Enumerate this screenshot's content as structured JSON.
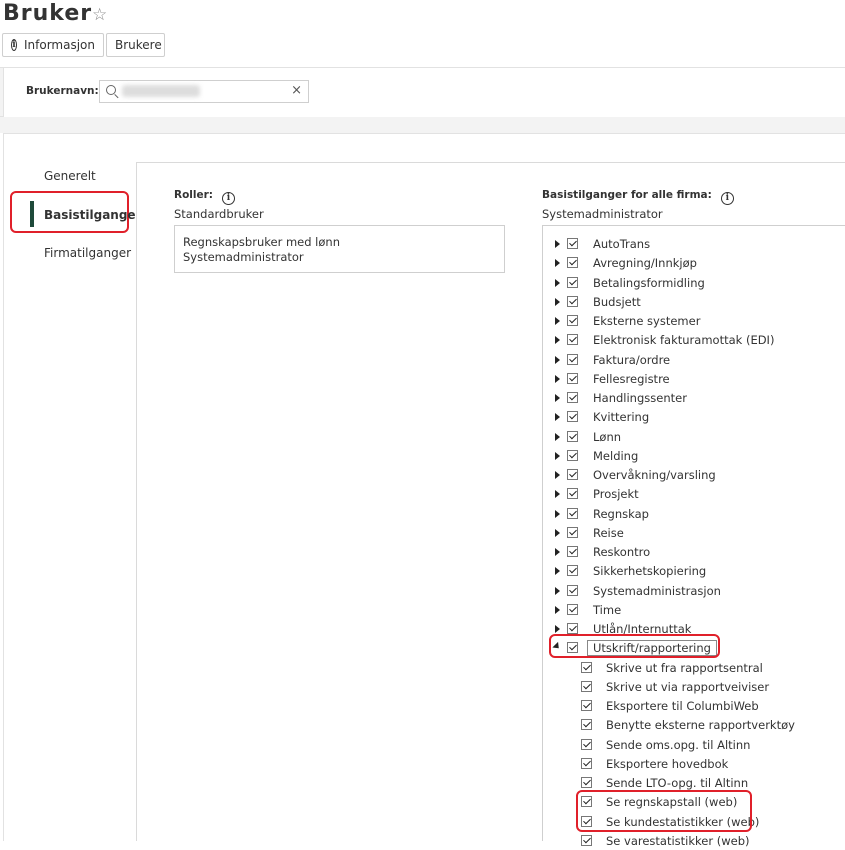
{
  "header": {
    "title": "Bruker",
    "star_icon": "star-outline-icon",
    "buttons": {
      "info": "Informasjon",
      "users": "Brukere"
    }
  },
  "search": {
    "label": "Brukernavn:",
    "value": "",
    "clear_symbol": "×"
  },
  "nav": {
    "items": [
      "Generelt",
      "Basistilganger",
      "Firmatilganger"
    ],
    "active": "Basistilganger"
  },
  "roles": {
    "label": "Roller:",
    "subtitle": "Standardbruker",
    "list": [
      "Regnskapsbruker med lønn",
      "Systemadministrator"
    ]
  },
  "access": {
    "label": "Basistilganger for alle firma:",
    "subtitle": "Systemadministrator",
    "modules": [
      "AutoTrans",
      "Avregning/Innkjøp",
      "Betalingsformidling",
      "Budsjett",
      "Eksterne systemer",
      "Elektronisk fakturamottak (EDI)",
      "Faktura/ordre",
      "Fellesregistre",
      "Handlingssenter",
      "Kvittering",
      "Lønn",
      "Melding",
      "Overvåkning/varsling",
      "Prosjekt",
      "Regnskap",
      "Reise",
      "Reskontro",
      "Sikkerhetskopiering",
      "Systemadministrasjon",
      "Time",
      "Utlån/Internuttak"
    ],
    "expanded": {
      "label": "Utskrift/rapportering",
      "children": [
        "Skrive ut fra rapportsentral",
        "Skrive ut via rapportveiviser",
        "Eksportere til ColumbiWeb",
        "Benytte eksterne rapportverktøy",
        "Sende oms.opg. til Altinn",
        "Eksportere hovedbok",
        "Sende LTO-opg. til Altinn",
        "Se regnskapstall (web)",
        "Se kundestatistikker (web)",
        "Se varestatistikker (web)"
      ]
    }
  },
  "colors": {
    "highlight": "#e0202a",
    "nav_active_bar": "#1e4a3a"
  }
}
